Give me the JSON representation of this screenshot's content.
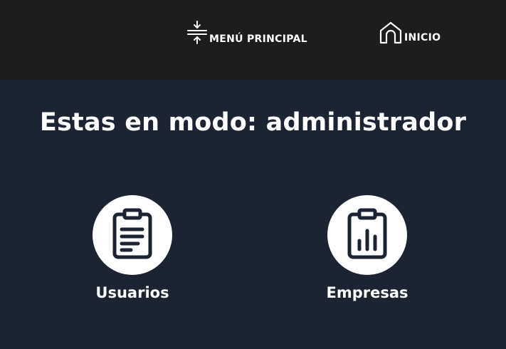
{
  "colors": {
    "topbar_bg": "#1d1d1d",
    "page_bg": "#1b2430",
    "text": "#ffffff",
    "icon_dark": "#1b2430"
  },
  "nav": {
    "menu": {
      "label": "MENÚ PRINCIPAL",
      "icon": "collapse-vertical-icon"
    },
    "inicio": {
      "label": "INICIO",
      "icon": "home-icon"
    }
  },
  "title": "Estas en modo: administrador",
  "cards": [
    {
      "label": "Usuarios",
      "icon": "clipboard-list-icon"
    },
    {
      "label": "Empresas",
      "icon": "clipboard-chart-icon"
    }
  ]
}
